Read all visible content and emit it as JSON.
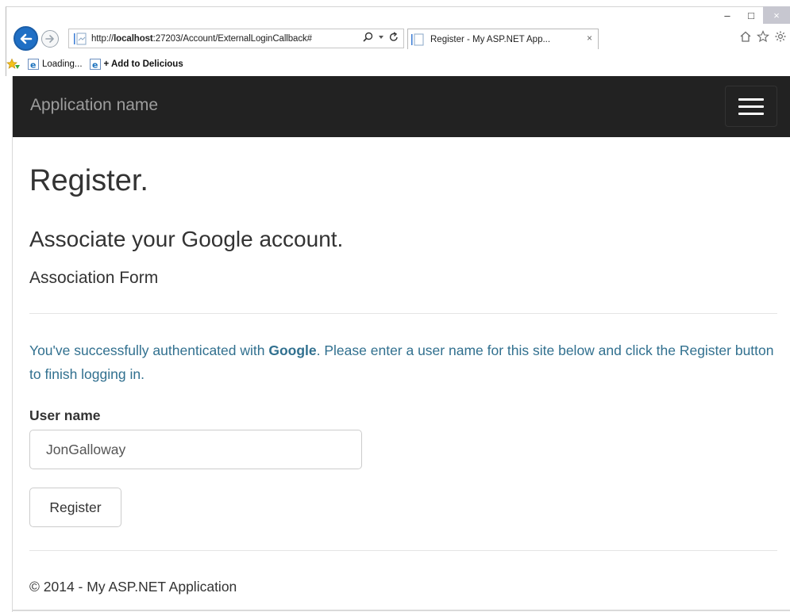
{
  "browser": {
    "address_prefix": "http://",
    "address_host": "localhost",
    "address_rest": ":27203/Account/ExternalLoginCallback#",
    "tab_title": "Register - My ASP.NET App...",
    "tab_close": "×",
    "window_controls": {
      "minimize": "–",
      "maximize": "□",
      "close": "×"
    },
    "favorites": [
      {
        "label": "Loading..."
      },
      {
        "label": "+ Add to Delicious"
      }
    ],
    "icons": [
      "back-arrow-icon",
      "forward-arrow-icon",
      "page-icon",
      "search-icon",
      "refresh-icon",
      "home-icon",
      "favorites-star-icon",
      "settings-gear-icon",
      "favorites-bar-star-icon",
      "ie-page-icon"
    ]
  },
  "navbar": {
    "brand": "Application name",
    "toggle_icon": "hamburger-menu-icon",
    "bg_color": "#222222"
  },
  "main": {
    "title": "Register.",
    "subtitle": "Associate your Google account.",
    "form_heading": "Association Form",
    "info_prefix": "You've successfully authenticated with ",
    "info_provider": "Google",
    "info_suffix": ". Please enter a user name for this site below and click the Register button to finish logging in.",
    "username_label": "User name",
    "username_value": "JonGalloway",
    "register_button": "Register",
    "info_color": "#31708f"
  },
  "footer": {
    "text": "© 2014 - My ASP.NET Application"
  }
}
